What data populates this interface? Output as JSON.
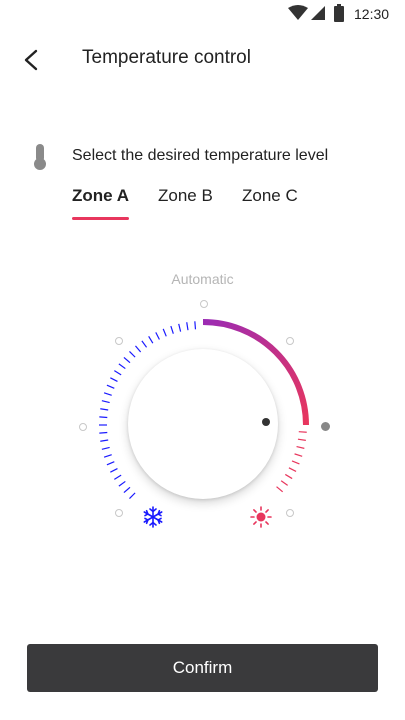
{
  "status": {
    "time": "12:30"
  },
  "header": {
    "title": "Temperature control"
  },
  "prompt": {
    "text": "Select the desired temperature level"
  },
  "tabs": [
    {
      "label": "Zone A",
      "active": true
    },
    {
      "label": "Zone B",
      "active": false
    },
    {
      "label": "Zone C",
      "active": false
    }
  ],
  "dial": {
    "mode_label": "Automatic",
    "cold_icon": "snowflake-icon",
    "hot_icon": "sun-icon",
    "cold_color": "#1a1aff",
    "hot_color": "#e8365d",
    "arc_start_color": "#9b2bb3",
    "arc_end_color": "#e8365d"
  },
  "actions": {
    "confirm_label": "Confirm"
  }
}
